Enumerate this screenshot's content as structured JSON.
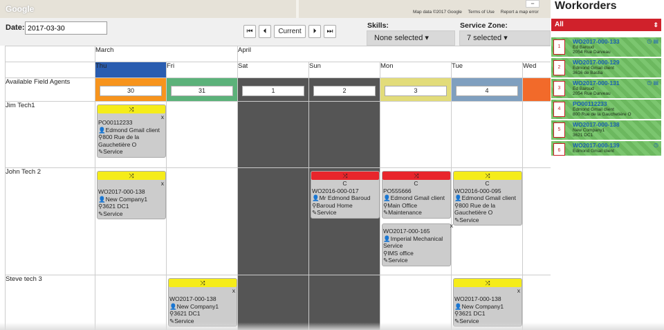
{
  "map": {
    "logo": "Google",
    "attribution": [
      "Map data ©2017 Google",
      "Terms of Use",
      "Report a map error"
    ],
    "zoom_out": "−"
  },
  "controls": {
    "date_label": "Date:",
    "date_value": "2017-03-30",
    "nav": {
      "first": "⏮",
      "prev": "⏴",
      "current": "Current",
      "next": "⏵",
      "last": "⏭"
    },
    "skills_label": "Skills:",
    "skills_value": "None selected ▾",
    "zone_label": "Service Zone:",
    "zone_value": "7 selected ▾"
  },
  "grid": {
    "months": [
      "March",
      "April"
    ],
    "days": [
      "Thu",
      "Fri",
      "Sat",
      "Sun",
      "Mon",
      "Tue",
      "Wed"
    ],
    "available_label": "Available Field Agents",
    "dates": [
      "30",
      "31",
      "1",
      "2",
      "3",
      "4"
    ],
    "agents": [
      "Jim Tech1",
      "John Tech 2",
      "Steve tech 3"
    ],
    "colors": {
      "thu": "#2a5db0",
      "day30": "#f7941d",
      "day31": "#5cb27a",
      "day3": "#e2dc7a",
      "day4": "#7f9fbf",
      "wed": "#f26a2a",
      "weekend": "#555555"
    }
  },
  "cards": {
    "c1": {
      "id": "PO00112233",
      "client": "Edmond Gmail client",
      "addr": "800 Rue de la Gauchetière O",
      "type": "Service"
    },
    "c2": {
      "id": "WO2017-000-138",
      "client": "New Company1",
      "addr": "3621 DC1",
      "type": "Service"
    },
    "c3": {
      "id": "WO2016-000-017",
      "client": "Mr Edmond Baroud",
      "addr": "Baroud Home",
      "type": "Service"
    },
    "c4": {
      "id": "PO555666",
      "client": "Edmond Gmail client",
      "addr": "Main Office",
      "type": "Maintenance"
    },
    "c5": {
      "id": "WO2017-000-165",
      "client": "Imperial Mechanical Service",
      "addr": "IMS office",
      "type": "Service"
    },
    "c6": {
      "id": "WO2016-000-095",
      "client": "Edmond Gmail client",
      "addr": "800 Rue de la Gauchetière O",
      "type": "Service"
    },
    "c7": {
      "id": "WO2017-000-138",
      "client": "New Company1",
      "addr": "3621 DC1",
      "type": "Service"
    },
    "c8": {
      "id": "WO2017-000-138",
      "client": "New Company1",
      "addr": "3621 DC1",
      "type": "Service"
    },
    "icons": {
      "shuffle": "⤨",
      "refresh": "C",
      "close": "x",
      "person": "👤",
      "pin": "⚲",
      "wrench": "✎"
    }
  },
  "side": {
    "title": "Workorders",
    "filter": "All",
    "filter_chev": "⇕",
    "items": [
      {
        "n": "1",
        "id": "WO2017-000-133",
        "l1": "Ed Baroud",
        "l2": "2054 Rue Darveau"
      },
      {
        "n": "2",
        "id": "WO2017-000-129",
        "l1": "Edmond Gmail client",
        "l2": "3616 de Bastia"
      },
      {
        "n": "3",
        "id": "WO2017-000-131",
        "l1": "Ed Baroud",
        "l2": "2054 Rue Darveau"
      },
      {
        "n": "4",
        "id": "PO00112233",
        "l1": "Edmond Gmail client",
        "l2": "800 Rue de la Gauchetière O"
      },
      {
        "n": "5",
        "id": "WO2017-000-138",
        "l1": "New Company1",
        "l2": "3621 DC1"
      },
      {
        "n": "6",
        "id": "WO2017-000-139",
        "l1": "Edmond Gmail client",
        "l2": ""
      }
    ]
  }
}
